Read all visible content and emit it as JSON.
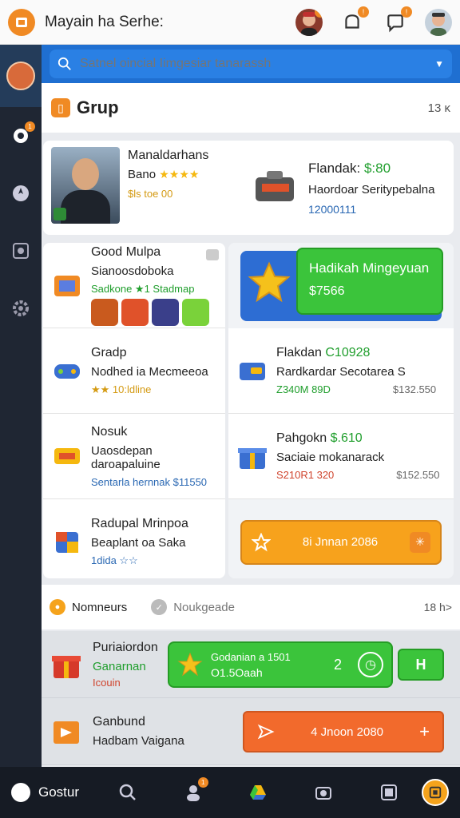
{
  "header": {
    "app_title": "Mayain ha Serhe:",
    "badges": [
      "!",
      "!",
      "!"
    ]
  },
  "search": {
    "placeholder": "Satnel oincial Iimgesiar tanarassh"
  },
  "sidebar": {
    "badge": "1"
  },
  "group": {
    "title": "Grup",
    "count": "13 ĸ"
  },
  "feature": {
    "name": "Manaldarhans",
    "sub": "Bano",
    "stars": "★★★★",
    "meta": "$ls toe 00",
    "right_title": "Flandak:",
    "right_price": "$:80",
    "right_sub": "Haordoar Seritypebalna",
    "right_num": "12000111"
  },
  "left_cells": [
    {
      "t1": "Good Mulpa",
      "t2": "Sianoosdoboka",
      "t3": "Sadkone ★1 Stadmap"
    },
    {
      "t1": "Gradp",
      "t2": "Nodhed ia Mecmeeoa",
      "t3": "★★ 10:ldline"
    },
    {
      "t1": "Nosuk",
      "t2": "Uaosdepan daroapaluine",
      "t3": "Sentarla hernnak $11550"
    },
    {
      "t1": "Radupal Mrinpoa",
      "t2": "Beaplant oa Saka",
      "t3": "1dida ☆☆"
    }
  ],
  "right_cells": [
    {
      "t1": "Flakdan",
      "t1b": "C10928",
      "t2": "Rardkardar Secotarea S",
      "t3": "Z340M 89D",
      "price": "$132.550"
    },
    {
      "t1": "Pahgokn",
      "t1b": "$.610",
      "t2": "Saciaie mokanarack",
      "t3": "S210R1 320",
      "price": "$152.550"
    }
  ],
  "promo_blue": {
    "line1": "Hadikah Mingeyuan",
    "line2": "$7566"
  },
  "promo_orange": {
    "label": "8i Jnnan 2086",
    "plus": "✳"
  },
  "tabs": {
    "active": "Nomneurs",
    "inactive": "Noukgeade",
    "count": "18 h>"
  },
  "lower": {
    "row1": {
      "l1": "Puriaiordon",
      "l2": "Ganarnan",
      "l3": "Icouin"
    },
    "green_bar": {
      "g1": "Godanian a 1501",
      "g2": "O1.5Oaah",
      "num": "2",
      "h": "H"
    },
    "row2": {
      "l1": "Ganbund",
      "l2": "Hadbam Vaigana"
    },
    "orange_btn": {
      "label": "4 Jnoon 2080",
      "plus": "+"
    }
  },
  "bottom_nav": {
    "home_label": "Gostur",
    "badge": "1"
  }
}
